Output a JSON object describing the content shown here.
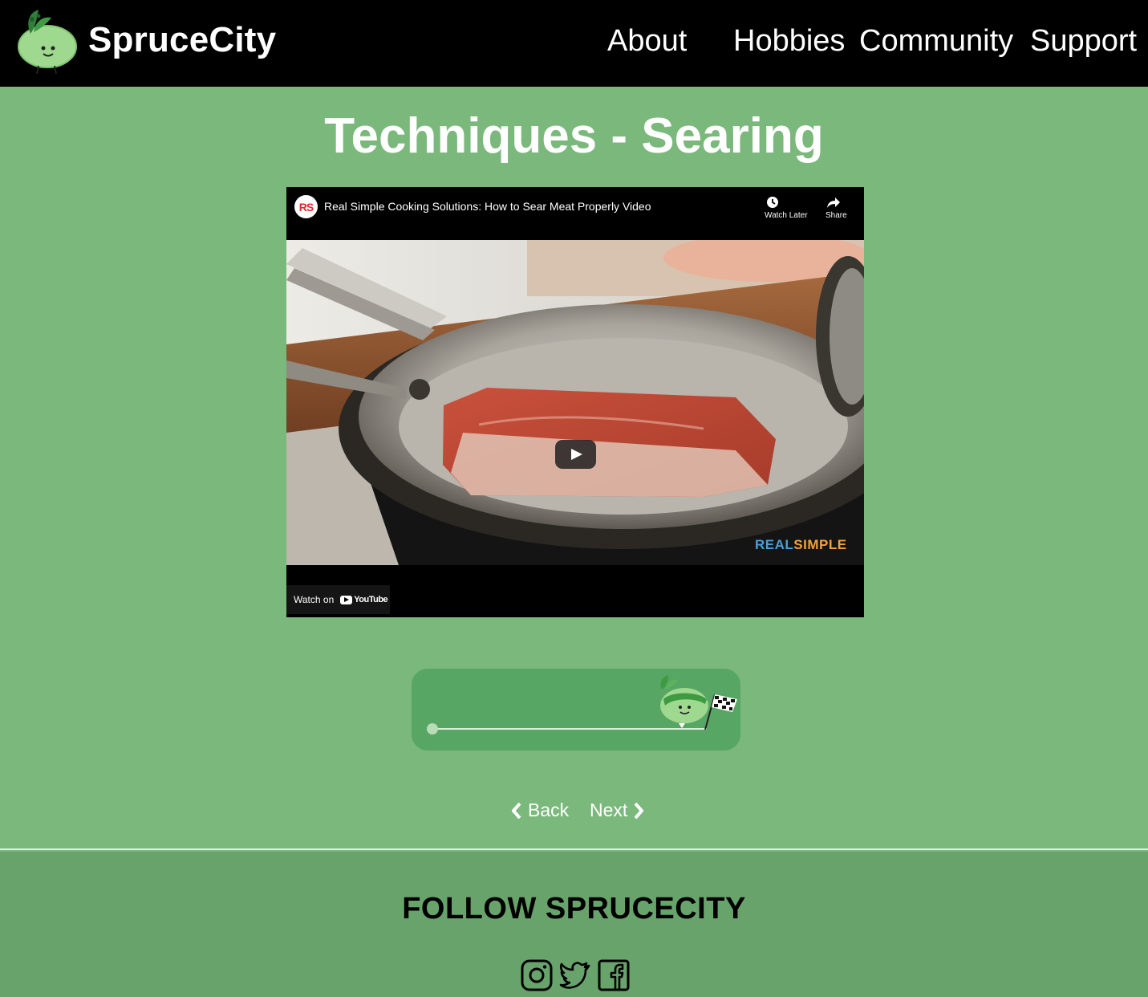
{
  "nav": {
    "brand": "SpruceCity",
    "links": [
      "About",
      "Hobbies",
      "Community",
      "Support"
    ]
  },
  "page": {
    "title": "Techniques - Searing"
  },
  "video": {
    "channel_avatar": "RS",
    "title": "Real Simple Cooking Solutions: How to Sear Meat Properly Video",
    "watch_later": "Watch Later",
    "share": "Share",
    "watch_on": "Watch on",
    "youtube": "YouTube",
    "watermark_real": "REAL",
    "watermark_simple": "SIMPLE",
    "play_icon": "play-icon"
  },
  "progress": {
    "value": 1.0,
    "icon_runner": "mascot-runner-icon",
    "icon_flag": "finish-flag-icon"
  },
  "pager": {
    "back": "Back",
    "next": "Next"
  },
  "footer": {
    "heading": "FOLLOW SPRUCECITY",
    "social": [
      "instagram-icon",
      "twitter-icon",
      "facebook-icon"
    ]
  },
  "colors": {
    "page_bg": "#7bb87c",
    "navbar_bg": "#000000",
    "progress_card": "#58a663",
    "footer_bg": "#68a36b",
    "watermark_real": "#4a9fd5",
    "watermark_simple": "#f2a23a"
  }
}
